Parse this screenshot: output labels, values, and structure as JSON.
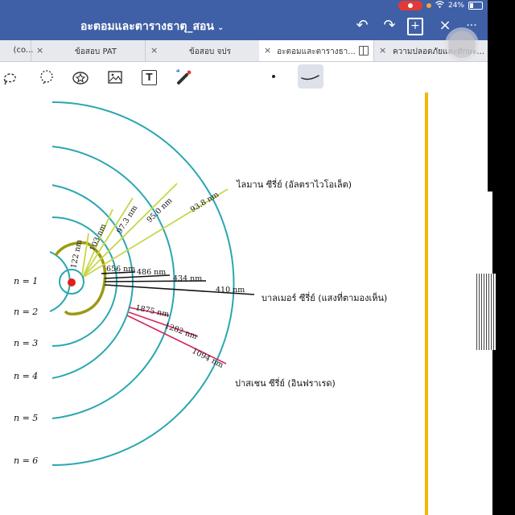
{
  "window": {
    "title": "อะตอมและตารางธาตุ_สอน",
    "battery": "24%",
    "title_chevron": "⌄",
    "undo_icon": "↶",
    "redo_icon": "↷",
    "add_page_icon": "+",
    "close_icon": "×",
    "more_icon": "···"
  },
  "tabs": [
    {
      "label": "(co...",
      "active": false
    },
    {
      "label": "ข้อสอบ PAT",
      "active": false
    },
    {
      "label": "ข้อสอบ จปร",
      "active": false
    },
    {
      "label": "อะตอมและตารางธา...",
      "active": true
    },
    {
      "label": "ความปลอดภัยและทักษะ...",
      "active": false
    }
  ],
  "tab_close_symbol": "×",
  "toolbar": {
    "tools": [
      "lasso-icon",
      "shape-icon",
      "sticker-icon",
      "image-icon",
      "text-icon",
      "laser-pointer-icon",
      "pen-dot-icon",
      "pen-stroke-icon"
    ],
    "text_tool_label": "T"
  },
  "diagram": {
    "levels": [
      "n = 1",
      "n = 2",
      "n = 3",
      "n = 4",
      "n = 5",
      "n = 6"
    ],
    "lyman": {
      "series": "ไลมาน ซีรี่ย์ (อัลตราไวโอเล็ต)",
      "wavelengths": [
        "122 nm",
        "103 nm",
        "97.3 nm",
        "95.0 nm",
        "93.8 nm"
      ]
    },
    "balmer": {
      "series": "บาลเมอร์ ซีรี่ย์ (แสงที่ตามองเห็น)",
      "wavelengths": [
        "656 nm",
        "486 nm",
        "434 nm",
        "410 nm"
      ]
    },
    "paschen": {
      "series": "ปาสเชน ซีรี่ย์ (อินฟราเรด)",
      "wavelengths": [
        "1875 nm",
        "1282 nm",
        "1094 nm"
      ]
    },
    "colors": {
      "orbit": "#2aa7b0",
      "lyman": "#c9d649",
      "balmer": "#111111",
      "paschen": "#d4275b",
      "nucleus": "#e0201e",
      "annotation": "#9a9a12",
      "margin": "#f2b707"
    }
  }
}
